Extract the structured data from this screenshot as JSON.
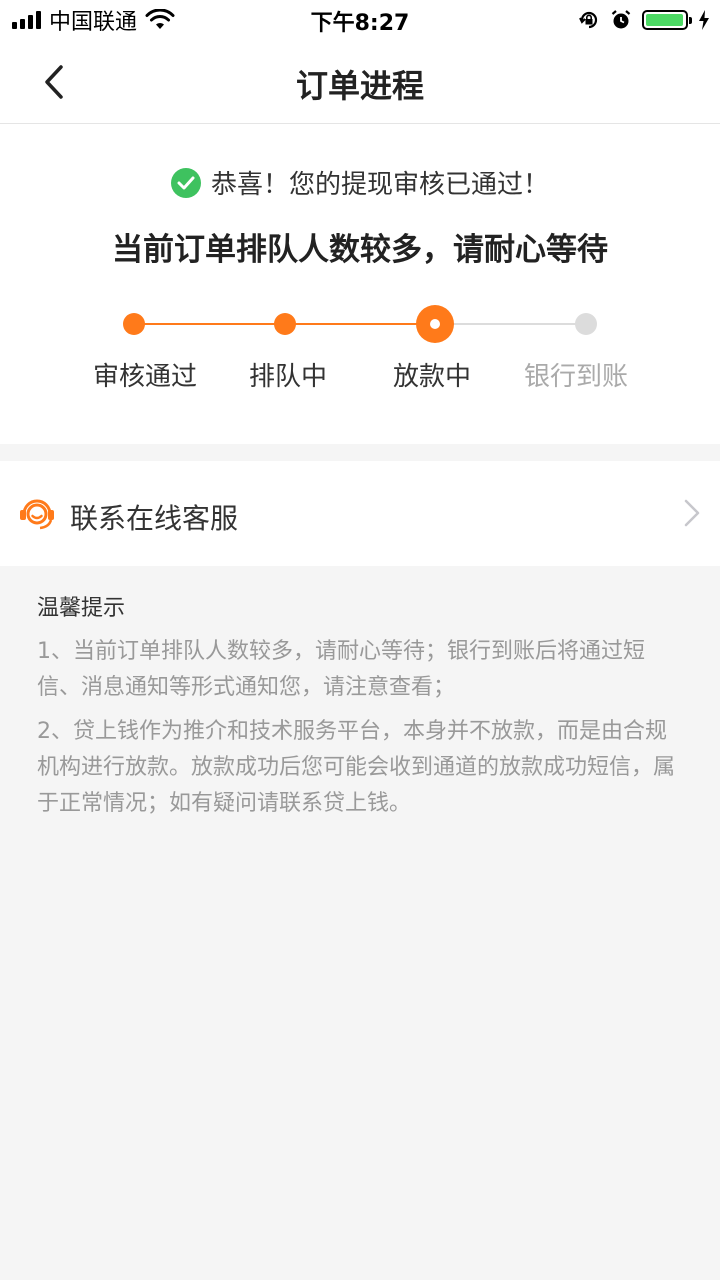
{
  "status_bar": {
    "carrier": "中国联通",
    "time": "下午8:27"
  },
  "nav": {
    "title": "订单进程"
  },
  "progress": {
    "success_message": "恭喜！您的提现审核已通过！",
    "queue_message": "当前订单排队人数较多，请耐心等待",
    "steps": [
      {
        "label": "审核通过",
        "state": "done"
      },
      {
        "label": "排队中",
        "state": "done"
      },
      {
        "label": "放款中",
        "state": "current"
      },
      {
        "label": "银行到账",
        "state": "todo"
      }
    ],
    "colors": {
      "accent": "#ff7a1a",
      "inactive": "#dcdcdc",
      "success": "#3ec25f"
    }
  },
  "contact": {
    "label": "联系在线客服"
  },
  "tips": {
    "title": "温馨提示",
    "items": [
      "1、当前订单排队人数较多，请耐心等待；银行到账后将通过短信、消息通知等形式通知您，请注意查看；",
      "2、贷上钱作为推介和技术服务平台，本身并不放款，而是由合规机构进行放款。放款成功后您可能会收到通道的放款成功短信，属于正常情况；如有疑问请联系贷上钱。"
    ]
  }
}
